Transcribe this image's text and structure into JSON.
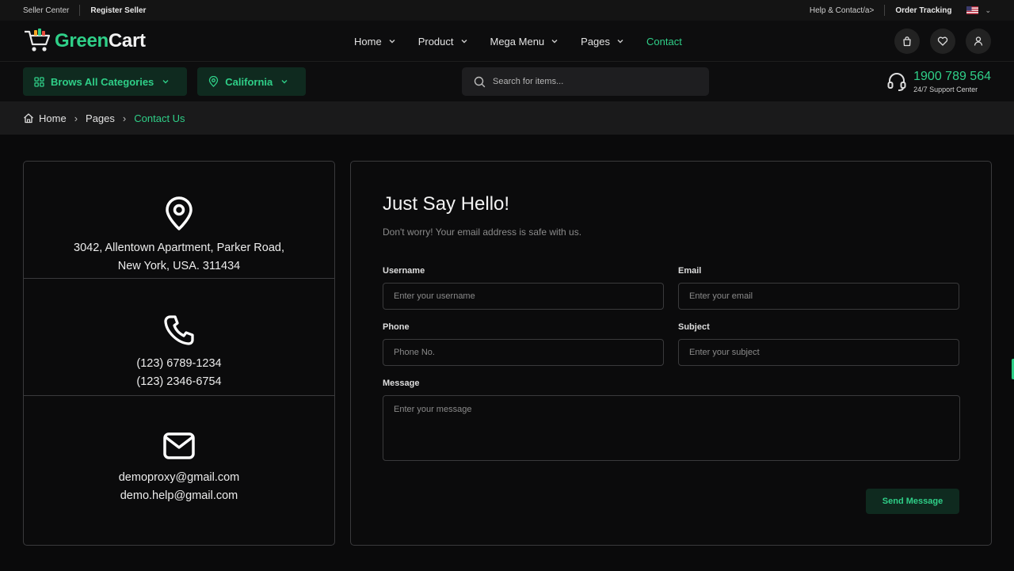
{
  "topbar": {
    "seller_center": "Seller Center",
    "register_seller": "Register Seller",
    "help": "Help & Contact/a>",
    "order_tracking": "Order Tracking"
  },
  "brand": {
    "name_green": "Green",
    "name_white": "Cart"
  },
  "menu": [
    {
      "label": "Home",
      "dropdown": true
    },
    {
      "label": "Product",
      "dropdown": true
    },
    {
      "label": "Mega Menu",
      "dropdown": true
    },
    {
      "label": "Pages",
      "dropdown": true
    },
    {
      "label": "Contact",
      "dropdown": false
    }
  ],
  "subbar": {
    "categories_label": "Brows All Categories",
    "location_label": "California",
    "search_placeholder": "Search for items...",
    "phone": "1900 789 564",
    "support_label": "24/7 Support Center"
  },
  "breadcrumb": [
    "Home",
    "Pages",
    "Contact Us"
  ],
  "contact_info": {
    "address": [
      "3042, Allentown Apartment, Parker Road,",
      "New York, USA. 311434"
    ],
    "phones": [
      "(123) 6789-1234",
      "(123) 2346-6754"
    ],
    "emails": [
      "demoproxy@gmail.com",
      "demo.help@gmail.com"
    ]
  },
  "form": {
    "title": "Just Say Hello!",
    "subtitle": "Don't worry! Your email address is safe with us.",
    "username_label": "Username",
    "username_placeholder": "Enter your username",
    "email_label": "Email",
    "email_placeholder": "Enter your email",
    "phone_label": "Phone",
    "phone_placeholder": "Phone No.",
    "subject_label": "Subject",
    "subject_placeholder": "Enter your subject",
    "message_label": "Message",
    "message_placeholder": "Enter your message",
    "submit_label": "Send Message"
  },
  "colors": {
    "accent": "#2fcf88",
    "accent_bg": "#0f2a1f",
    "bg": "#0a0a0b"
  },
  "icons": [
    "cart-logo-icon",
    "bag-icon",
    "heart-icon",
    "user-icon",
    "grid-icon",
    "location-pin-icon",
    "search-icon",
    "headset-icon",
    "home-icon",
    "phone-icon",
    "mail-icon",
    "us-flag-icon"
  ]
}
